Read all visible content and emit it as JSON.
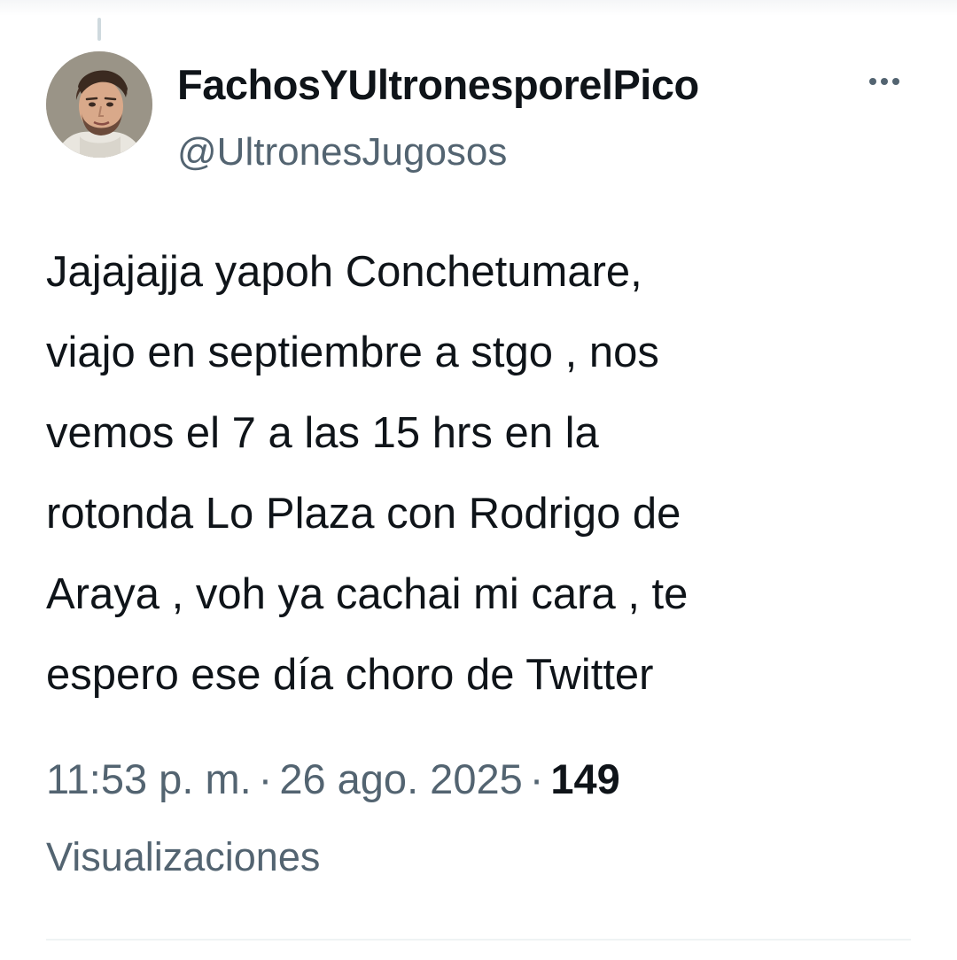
{
  "tweet": {
    "author": {
      "display_name": "FachosYUltronesporelPico",
      "handle": "@UltronesJugosos",
      "avatar_icon": "user-avatar"
    },
    "more_icon": "more-options-icon",
    "text": "Jajajajja yapoh Conchetumare,\nviajo en septiembre a stgo , nos\nvemos el 7 a las 15 hrs en la\nrotonda Lo Plaza con Rodrigo de\nAraya , voh ya cachai mi cara , te\nespero ese día choro de Twitter",
    "time": "11:53 p. m.",
    "separator": "·",
    "date": "26 ago. 2025",
    "views_count": "149",
    "views_label": "Visualizaciones"
  },
  "colors": {
    "primary_text": "#0f1419",
    "secondary_text": "#536471",
    "divider": "#eff3f4",
    "thread_line": "#cfd9de"
  }
}
